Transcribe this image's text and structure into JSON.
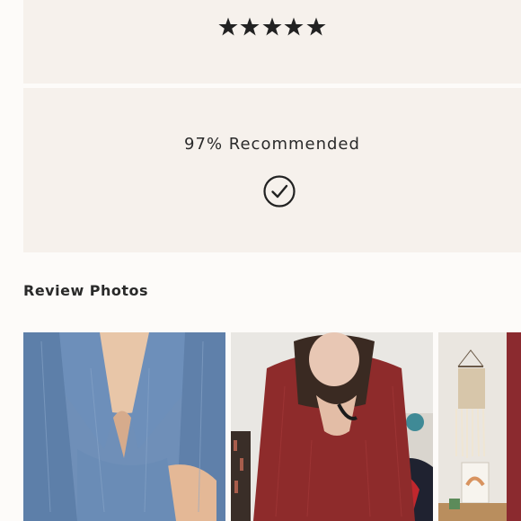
{
  "rating": {
    "stars": 5,
    "star_color": "#222222"
  },
  "recommend": {
    "text": "97% Recommended",
    "icon": "check-circle-icon"
  },
  "review_photos": {
    "title": "Review Photos",
    "photos": [
      {
        "name": "review-photo-blue-sweater"
      },
      {
        "name": "review-photo-red-sweater"
      },
      {
        "name": "review-photo-room-wall-hanging"
      }
    ]
  },
  "colors": {
    "page_background": "#fdfbf9",
    "card_background": "#f6f1ec",
    "text": "#222222"
  }
}
